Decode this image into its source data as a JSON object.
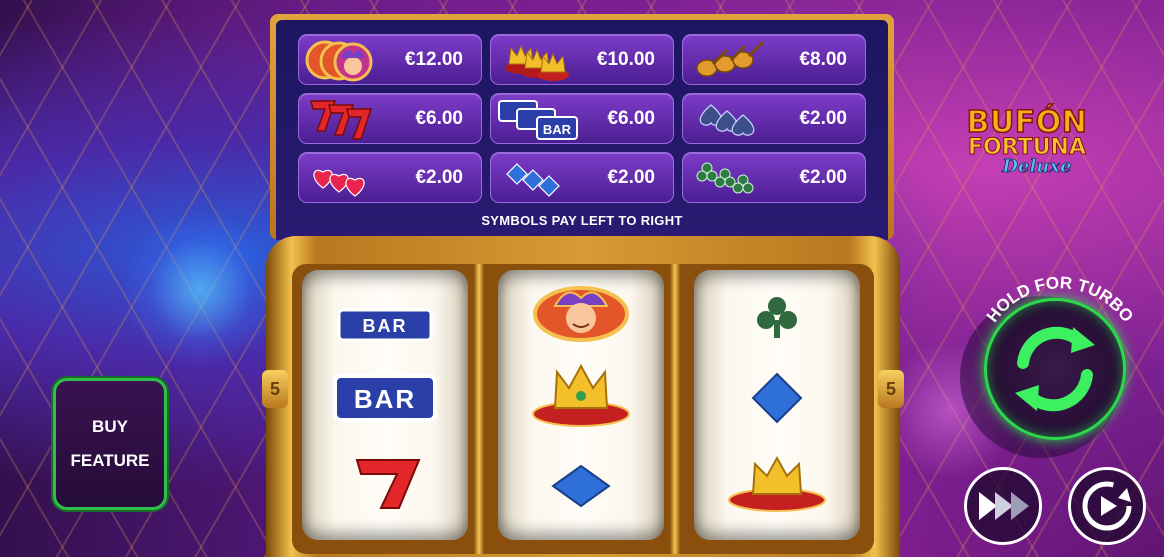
{
  "game": {
    "logo": {
      "line1": "BUFÓN",
      "line2": "FORTUNA",
      "line3": "Deluxe"
    }
  },
  "paytable": {
    "note": "SYMBOLS PAY LEFT TO RIGHT",
    "rows": [
      [
        {
          "symbol": "jester-icon",
          "amount": "€12.00"
        },
        {
          "symbol": "crown-icon",
          "amount": "€10.00"
        },
        {
          "symbol": "mandolin-icon",
          "amount": "€8.00"
        }
      ],
      [
        {
          "symbol": "seven-icon",
          "amount": "€6.00"
        },
        {
          "symbol": "bar-icon",
          "amount": "€6.00"
        },
        {
          "symbol": "spade-icon",
          "amount": "€2.00"
        }
      ],
      [
        {
          "symbol": "heart-icon",
          "amount": "€2.00"
        },
        {
          "symbol": "diamond-icon",
          "amount": "€2.00"
        },
        {
          "symbol": "club-icon",
          "amount": "€2.00"
        }
      ]
    ],
    "bar_text": "BAR"
  },
  "reels": {
    "lines_left": "5",
    "lines_right": "5",
    "columns": [
      [
        "bar-icon",
        "bar-icon",
        "seven-icon"
      ],
      [
        "jester-icon",
        "crown-icon",
        "diamond-icon"
      ],
      [
        "club-icon",
        "diamond-icon",
        "crown-icon"
      ]
    ],
    "bar_text": "BAR"
  },
  "buy_feature": {
    "line1": "BUY",
    "line2": "FEATURE"
  },
  "spin": {
    "turbo_label": "HOLD FOR TURBO"
  },
  "colors": {
    "accent_green": "#2bd94a",
    "gold": "#d89a34",
    "panel_purple": "#4b1e92"
  }
}
